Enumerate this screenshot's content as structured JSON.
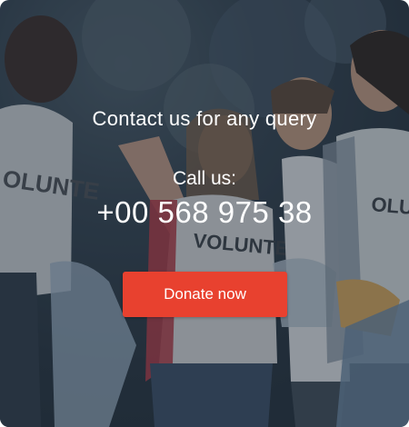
{
  "contact": {
    "headline": "Contact us for any query",
    "call_label": "Call us:",
    "phone": "+00 568 975 38",
    "donate_label": "Donate now"
  },
  "background": {
    "shirt_text": "VOLUNTEER",
    "accent_color": "#e8412f"
  }
}
